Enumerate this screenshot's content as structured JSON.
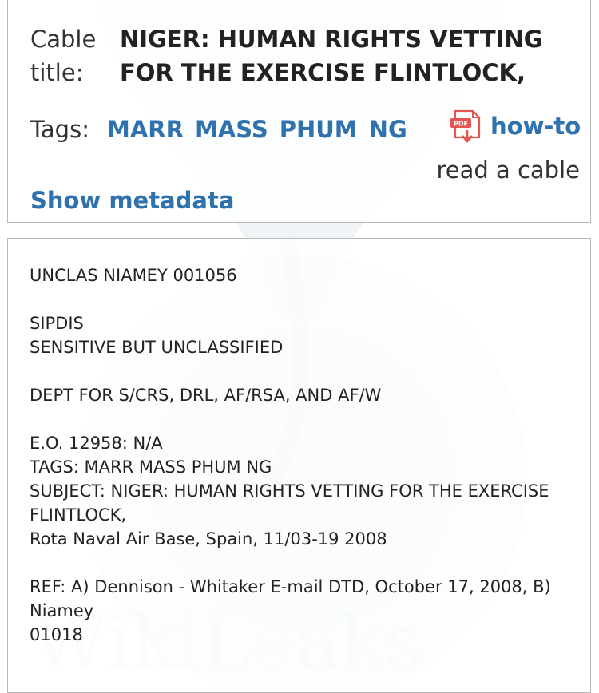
{
  "cable": {
    "title_label": "Cable title:",
    "title": "NIGER: HUMAN RIGHTS VETTING FOR THE EXERCISE FLINTLOCK,",
    "tags_label": "Tags:",
    "tags": [
      "MARR",
      "MASS",
      "PHUM",
      "NG"
    ],
    "show_metadata": "Show metadata",
    "howto_link": "how-to",
    "howto_sub": "read a cable",
    "pdf_icon_text": "PDF"
  },
  "body_lines": [
    "UNCLAS NIAMEY 001056",
    "",
    "SIPDIS",
    "SENSITIVE BUT UNCLASSIFIED",
    "",
    "DEPT FOR S/CRS, DRL, AF/RSA, AND AF/W",
    "",
    "E.O. 12958: N/A",
    "TAGS: MARR MASS PHUM NG",
    "SUBJECT: NIGER: HUMAN RIGHTS VETTING FOR THE EXERCISE",
    "FLINTLOCK,",
    "Rota Naval Air Base, Spain, 11/03-19 2008",
    "",
    "REF: A) Dennison - Whitaker E-mail DTD, October 17, 2008, B)",
    "Niamey",
    "01018"
  ],
  "watermark": {
    "text": "WikiLeaks",
    "color": "#4a7fa0"
  },
  "colors": {
    "link": "#2f72ad",
    "pdf_red": "#e4554f",
    "border": "#b9b9b9"
  }
}
